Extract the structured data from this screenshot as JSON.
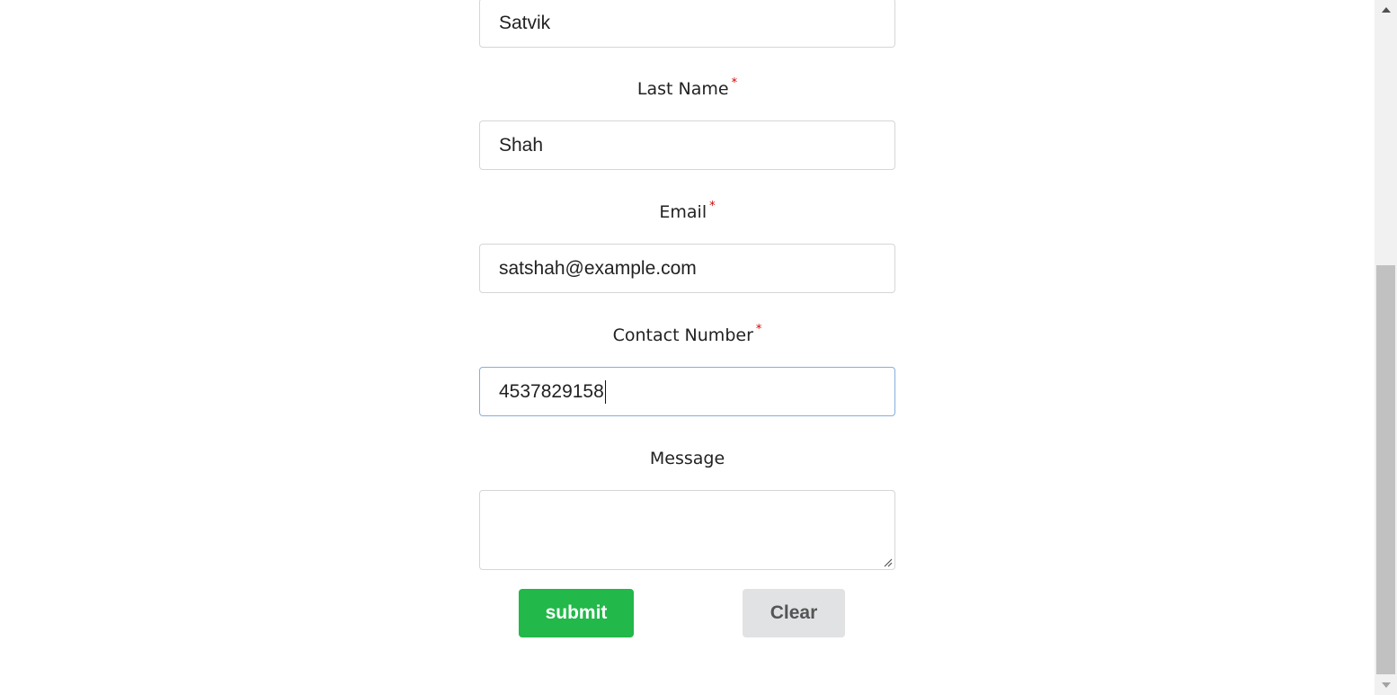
{
  "form": {
    "first_name": {
      "value": "Satvik"
    },
    "last_name": {
      "label": "Last Name",
      "required_marker": "*",
      "value": "Shah"
    },
    "email": {
      "label": "Email",
      "required_marker": "*",
      "value": "satshah@example.com"
    },
    "contact_number": {
      "label": "Contact Number",
      "required_marker": "*",
      "value": "4537829158"
    },
    "message": {
      "label": "Message",
      "value": ""
    },
    "submit_label": "submit",
    "clear_label": "Clear"
  },
  "colors": {
    "submit_bg": "#22b84a",
    "clear_bg": "#e1e2e4",
    "required": "#d40000",
    "focus_border": "#86aedb"
  }
}
